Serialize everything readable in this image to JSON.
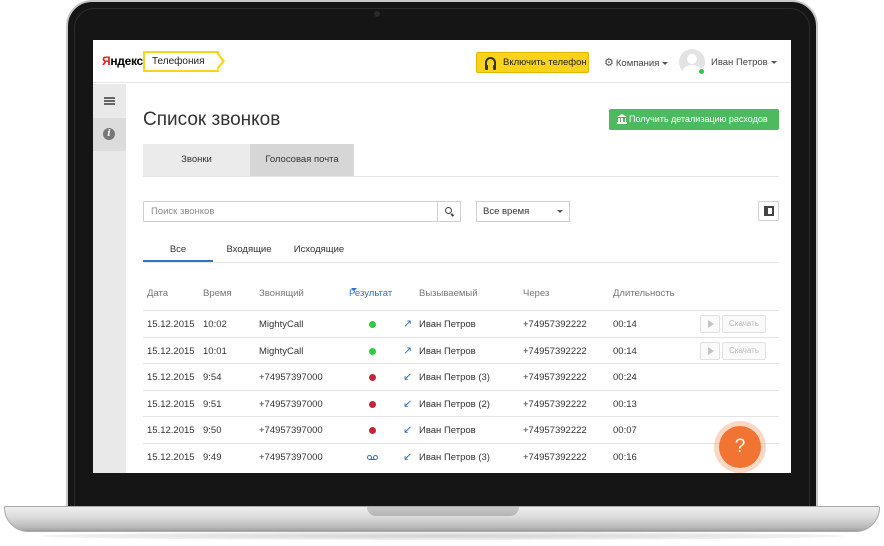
{
  "header": {
    "logo_ya": "Я",
    "logo_rest": "ндекс",
    "product_tag": "Телефония",
    "phone_button_label": "Включить телефон",
    "company_label": "Компания",
    "user_name": "Иван Петров"
  },
  "sidebar": {
    "info_glyph": "i"
  },
  "main": {
    "title": "Список звонков",
    "expense_button_label": "Получить детализацию расходов",
    "tabs": [
      {
        "label": "Звонки"
      },
      {
        "label": "Голосовая почта"
      }
    ],
    "search_placeholder": "Поиск звонков",
    "time_filter_value": "Все время",
    "direction_filters": [
      {
        "label": "Все",
        "active": true
      },
      {
        "label": "Входящие"
      },
      {
        "label": "Исходящие"
      }
    ]
  },
  "table": {
    "columns": [
      "Дата",
      "Время",
      "Звонящий",
      "Результат",
      "Вызываемый",
      "Через",
      "Длительность"
    ],
    "play_label": "▶",
    "download_label": "Скачать",
    "rows": [
      {
        "date": "15.12.2015",
        "time": "10:02",
        "caller": "MightyCall",
        "result": "answered",
        "callee": "Иван Петров",
        "via": "+74957392222",
        "duration": "00:14",
        "has_record": true,
        "direction": "outgoing"
      },
      {
        "date": "15.12.2015",
        "time": "10:01",
        "caller": "MightyCall",
        "result": "answered",
        "callee": "Иван Петров",
        "via": "+74957392222",
        "duration": "00:14",
        "has_record": true,
        "direction": "outgoing"
      },
      {
        "date": "15.12.2015",
        "time": "9:54",
        "caller": "+74957397000",
        "result": "missed",
        "callee": "Иван Петров (3)",
        "via": "+74957392222",
        "duration": "00:24",
        "has_record": false,
        "direction": "incoming"
      },
      {
        "date": "15.12.2015",
        "time": "9:51",
        "caller": "+74957397000",
        "result": "missed",
        "callee": "Иван Петров (2)",
        "via": "+74957392222",
        "duration": "00:13",
        "has_record": false,
        "direction": "incoming"
      },
      {
        "date": "15.12.2015",
        "time": "9:50",
        "caller": "+74957397000",
        "result": "missed",
        "callee": "Иван Петров",
        "via": "+74957392222",
        "duration": "00:07",
        "has_record": false,
        "direction": "incoming"
      },
      {
        "date": "15.12.2015",
        "time": "9:49",
        "caller": "+74957397000",
        "result": "voicemail",
        "callee": "Иван Петров (3)",
        "via": "+74957392222",
        "duration": "00:16",
        "has_record": false,
        "direction": "incoming"
      }
    ]
  },
  "help_button_label": "?",
  "colors": {
    "answered": "#2fcb3f",
    "missed": "#c0283a",
    "voicemail": "#2f73c4",
    "accent_blue": "#2f73c4",
    "green_button": "#4cbb5f",
    "yellow_button": "#fad21a",
    "help_orange": "#f27432"
  },
  "icons": {
    "outgoing": "↗",
    "incoming": "↙"
  }
}
